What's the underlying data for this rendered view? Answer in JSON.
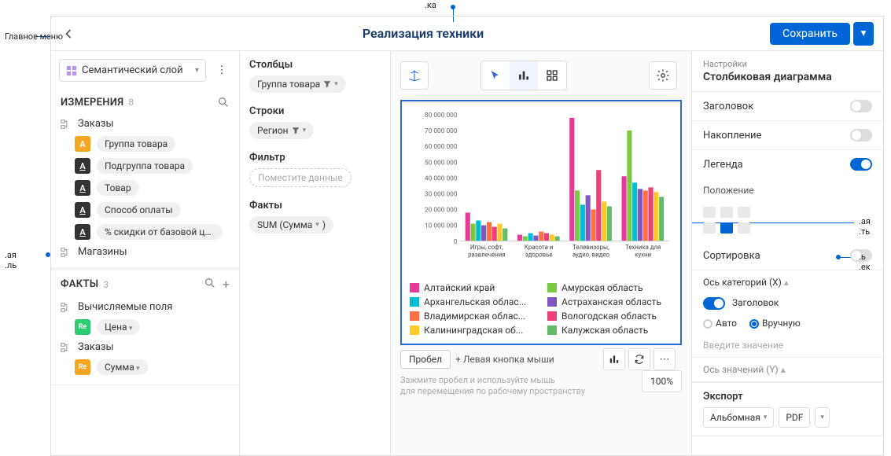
{
  "annotations": {
    "main_menu": "Главное\nменю",
    "top_label": "",
    "right_label": "",
    "sort_label": ""
  },
  "header": {
    "title": "Реализация техники",
    "save": "Сохранить"
  },
  "left": {
    "layer": "Семантический слой",
    "dimensions": {
      "title": "ИЗМЕРЕНИЯ",
      "count": "8"
    },
    "orders_node": "Заказы",
    "dims": [
      "Группа товара",
      "Подгруппа товара",
      "Товар",
      "Способ оплаты",
      "% скидки от базовой це..."
    ],
    "stores_node": "Магазины",
    "facts": {
      "title": "ФАКТЫ",
      "count": "3"
    },
    "calc_node": "Вычисляемые поля",
    "price": "Цена",
    "orders_node2": "Заказы",
    "sum": "Сумма"
  },
  "fields": {
    "cols_label": "Столбцы",
    "cols_val": "Группа товара",
    "rows_label": "Строки",
    "rows_val": "Регион",
    "filter_label": "Фильтр",
    "filter_ph": "Поместите данные",
    "facts_label": "Факты",
    "facts_val": "SUM (Сумма"
  },
  "canvas": {
    "probel": "Пробел",
    "probel_plus": "+ Левая кнопка мыши",
    "hint": "Зажмите пробел и используйте мышь\nдля перемещения по рабочему пространству",
    "zoom": "100%"
  },
  "right": {
    "settings": "Настройки",
    "chart_type": "Столбиковая диаграмма",
    "heading": "Заголовок",
    "stacking": "Накопление",
    "legend": "Легенда",
    "position": "Положение",
    "sorting": "Сортировка",
    "axis_x": "Ось категорий (X)",
    "axis_x_heading": "Заголовок",
    "auto": "Авто",
    "manual": "Вручную",
    "enter_val": "Введите значение",
    "axis_y": "Ось значений (Y)",
    "export": "Экспорт",
    "landscape": "Альбомная",
    "pdf": "PDF"
  },
  "chart_data": {
    "type": "bar",
    "title": "",
    "ylabel": "",
    "ylim": [
      0,
      80000000
    ],
    "y_ticks": [
      0,
      10000000,
      20000000,
      30000000,
      40000000,
      50000000,
      60000000,
      70000000,
      80000000
    ],
    "y_tick_labels": [
      "0",
      "10 000 000",
      "20 000 000",
      "30 000 000",
      "40 000 000",
      "50 000 000",
      "60 000 000",
      "70 000 000",
      "80 000 000"
    ],
    "categories": [
      "Игры, софт, развлечения",
      "Красота и здоровье",
      "Телевизоры, аудио, видео",
      "Техника для кухни"
    ],
    "series": [
      {
        "name": "Алтайский край",
        "color": "#e6399b",
        "values": [
          18000000,
          4000000,
          78000000,
          41000000
        ]
      },
      {
        "name": "Амурская область",
        "color": "#7ac943",
        "values": [
          11000000,
          3000000,
          32000000,
          70000000
        ]
      },
      {
        "name": "Архангельская область",
        "color": "#00bcd4",
        "values": [
          13000000,
          5000000,
          23000000,
          37000000
        ]
      },
      {
        "name": "Астраханская область",
        "color": "#7e57c2",
        "values": [
          10000000,
          3500000,
          29000000,
          33000000
        ]
      },
      {
        "name": "Владимирская область",
        "color": "#ff7043",
        "values": [
          12000000,
          6000000,
          20000000,
          32000000
        ]
      },
      {
        "name": "Вологодская область",
        "color": "#ec407a",
        "values": [
          9000000,
          5000000,
          45000000,
          34000000
        ]
      },
      {
        "name": "Калининградская область",
        "color": "#ffca28",
        "values": [
          11000000,
          4000000,
          25000000,
          31000000
        ]
      },
      {
        "name": "Калужская область",
        "color": "#66bb6a",
        "values": [
          8000000,
          3000000,
          22000000,
          28000000
        ]
      }
    ],
    "legend_display": [
      "Алтайский край",
      "Амурская область",
      "Архангельская облас...",
      "Астраханская область",
      "Владимирская облас...",
      "Вологодская область",
      "Калининградская об...",
      "Калужская область"
    ]
  }
}
